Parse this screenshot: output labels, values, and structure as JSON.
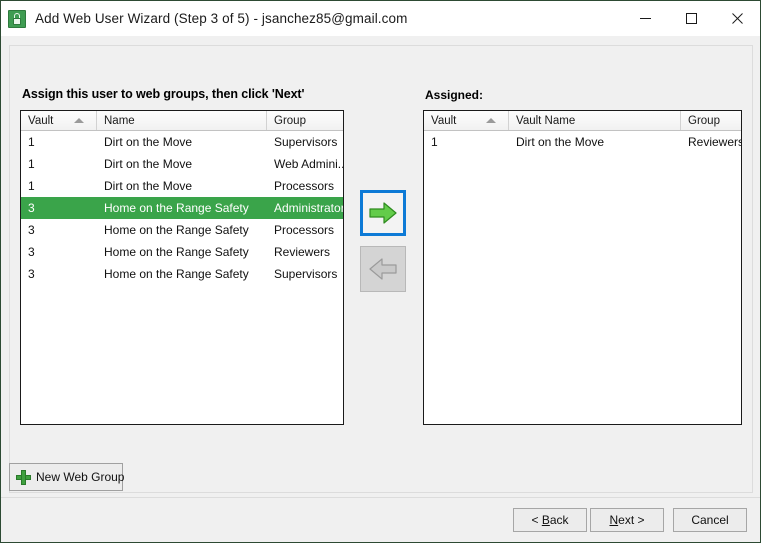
{
  "window": {
    "title": "Add Web User Wizard (Step 3 of 5) - jsanchez85@gmail.com",
    "app_icon": "vault-lock-icon",
    "controls": {
      "minimize": "minimize-icon",
      "maximize": "maximize-icon",
      "close": "close-icon"
    }
  },
  "main": {
    "instruction": "Assign this user to web groups, then click 'Next'",
    "assigned_label": "Assigned:"
  },
  "available_grid": {
    "columns": [
      "Vault",
      "Name",
      "Group"
    ],
    "sort_column": "Vault",
    "sort_direction": "ascending",
    "selected_row_index": 3,
    "rows": [
      {
        "vault": "1",
        "name": "Dirt on the Move",
        "group": "Supervisors"
      },
      {
        "vault": "1",
        "name": "Dirt on the Move",
        "group": "Web Admini..."
      },
      {
        "vault": "1",
        "name": "Dirt on the Move",
        "group": "Processors"
      },
      {
        "vault": "3",
        "name": "Home on the Range Safety",
        "group": "Administrators"
      },
      {
        "vault": "3",
        "name": "Home on the Range Safety",
        "group": "Processors"
      },
      {
        "vault": "3",
        "name": "Home on the Range Safety",
        "group": "Reviewers"
      },
      {
        "vault": "3",
        "name": "Home on the Range Safety",
        "group": "Supervisors"
      }
    ]
  },
  "assigned_grid": {
    "columns": [
      "Vault",
      "Vault Name",
      "Group"
    ],
    "sort_column": "Vault",
    "sort_direction": "ascending",
    "rows": [
      {
        "vault": "1",
        "name": "Dirt on the Move",
        "group": "Reviewers"
      }
    ]
  },
  "transfer": {
    "add_icon": "arrow-right-icon",
    "remove_icon": "arrow-left-icon",
    "add_enabled": true,
    "remove_enabled": false
  },
  "actions": {
    "new_web_group": "New Web Group",
    "new_web_group_icon": "plus-icon",
    "back": "< Back",
    "back_accel": "B",
    "next": "Next >",
    "next_accel": "N",
    "cancel": "Cancel"
  },
  "colors": {
    "selection_green": "#3aa44a",
    "focus_blue": "#0d7ad6",
    "arrow_green": "#5ec94a",
    "window_bg": "#f0f0f0"
  }
}
